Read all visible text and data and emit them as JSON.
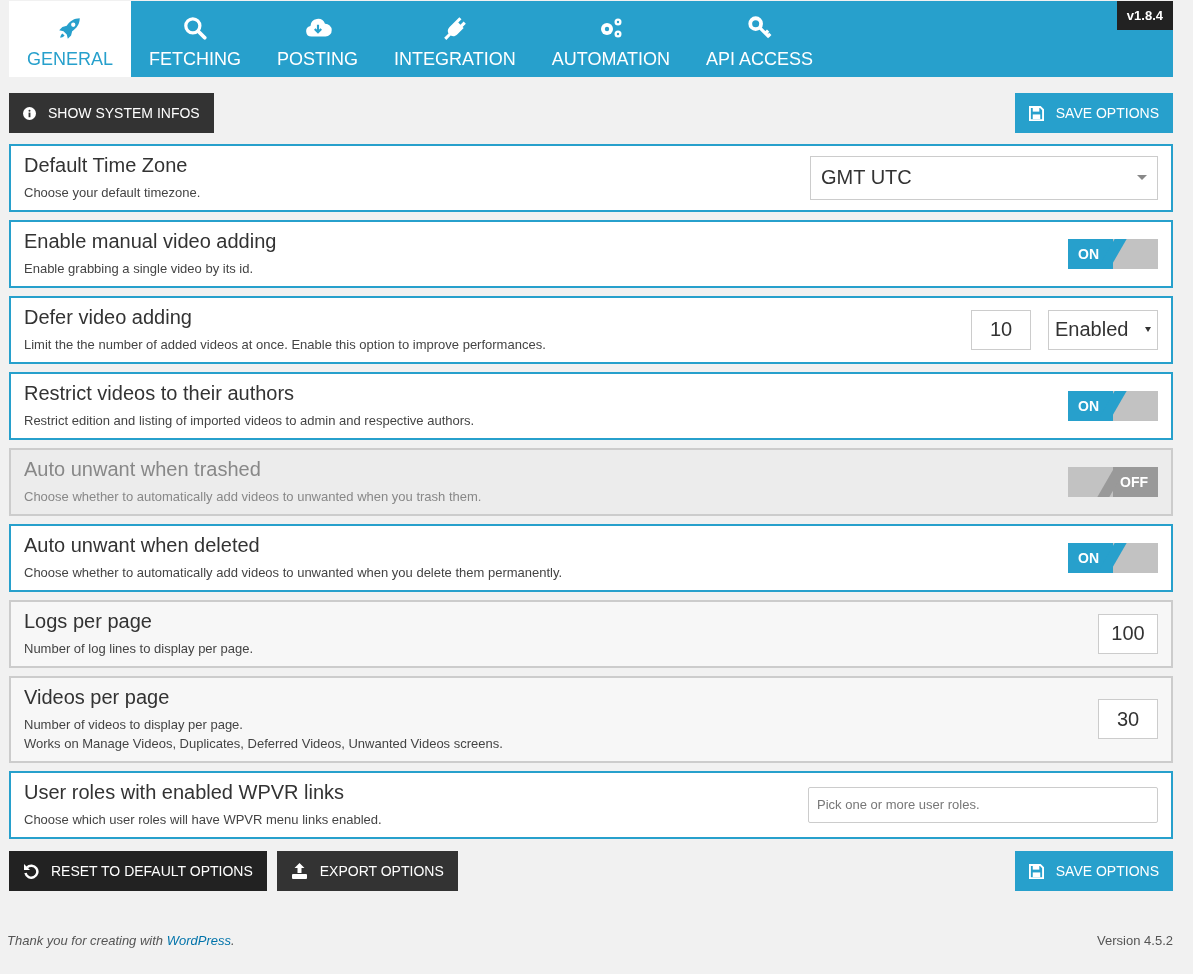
{
  "tabs": [
    {
      "label": "GENERAL",
      "selected": true
    },
    {
      "label": "FETCHING",
      "selected": false
    },
    {
      "label": "POSTING",
      "selected": false
    },
    {
      "label": "INTEGRATION",
      "selected": false
    },
    {
      "label": "AUTOMATION",
      "selected": false
    },
    {
      "label": "API ACCESS",
      "selected": false
    }
  ],
  "version_badge": "v1.8.4",
  "top_buttons": {
    "system_info": "SHOW SYSTEM INFOS",
    "save": "SAVE OPTIONS"
  },
  "options": [
    {
      "title": "Default Time Zone",
      "description": [
        "Choose your default timezone."
      ],
      "highlighted": true,
      "disabled": false,
      "control": {
        "kind": "select",
        "value": "GMT UTC"
      }
    },
    {
      "title": "Enable manual video adding",
      "description": [
        "Enable grabbing a single video by its id."
      ],
      "highlighted": true,
      "disabled": false,
      "control": {
        "kind": "toggle",
        "on": true,
        "label": "ON"
      }
    },
    {
      "title": "Defer video adding",
      "description": [
        "Limit the the number of added videos at once. Enable this option to improve performances."
      ],
      "highlighted": true,
      "disabled": false,
      "control": {
        "kind": "number_select",
        "value": "10",
        "select_value": "Enabled"
      }
    },
    {
      "title": "Restrict videos to their authors",
      "description": [
        "Restrict edition and listing of imported videos to admin and respective authors."
      ],
      "highlighted": true,
      "disabled": false,
      "control": {
        "kind": "toggle",
        "on": true,
        "label": "ON"
      }
    },
    {
      "title": "Auto unwant when trashed",
      "description": [
        "Choose whether to automatically add videos to unwanted when you trash them."
      ],
      "highlighted": false,
      "disabled": true,
      "control": {
        "kind": "toggle",
        "on": false,
        "label": "OFF"
      }
    },
    {
      "title": "Auto unwant when deleted",
      "description": [
        "Choose whether to automatically add videos to unwanted when you delete them permanently."
      ],
      "highlighted": true,
      "disabled": false,
      "control": {
        "kind": "toggle",
        "on": true,
        "label": "ON"
      }
    },
    {
      "title": "Logs per page",
      "description": [
        "Number of log lines to display per page."
      ],
      "highlighted": false,
      "disabled": false,
      "control": {
        "kind": "number",
        "value": "100"
      }
    },
    {
      "title": "Videos per page",
      "description": [
        "Number of videos to display per page.",
        "Works on Manage Videos, Duplicates, Deferred Videos, Unwanted Videos screens."
      ],
      "highlighted": false,
      "disabled": false,
      "control": {
        "kind": "number",
        "value": "30"
      }
    },
    {
      "title": "User roles with enabled WPVR links",
      "description": [
        "Choose which user roles will have WPVR menu links enabled."
      ],
      "highlighted": true,
      "disabled": false,
      "control": {
        "kind": "tags",
        "placeholder": "Pick one or more user roles."
      }
    }
  ],
  "bottom_buttons": {
    "reset": "RESET TO DEFAULT OPTIONS",
    "export": "EXPORT OPTIONS",
    "save": "SAVE OPTIONS"
  },
  "footer": {
    "credit_before": "Thank you for creating with",
    "credit_link": "WordPress",
    "credit_after": ".",
    "version": "Version 4.5.2"
  }
}
